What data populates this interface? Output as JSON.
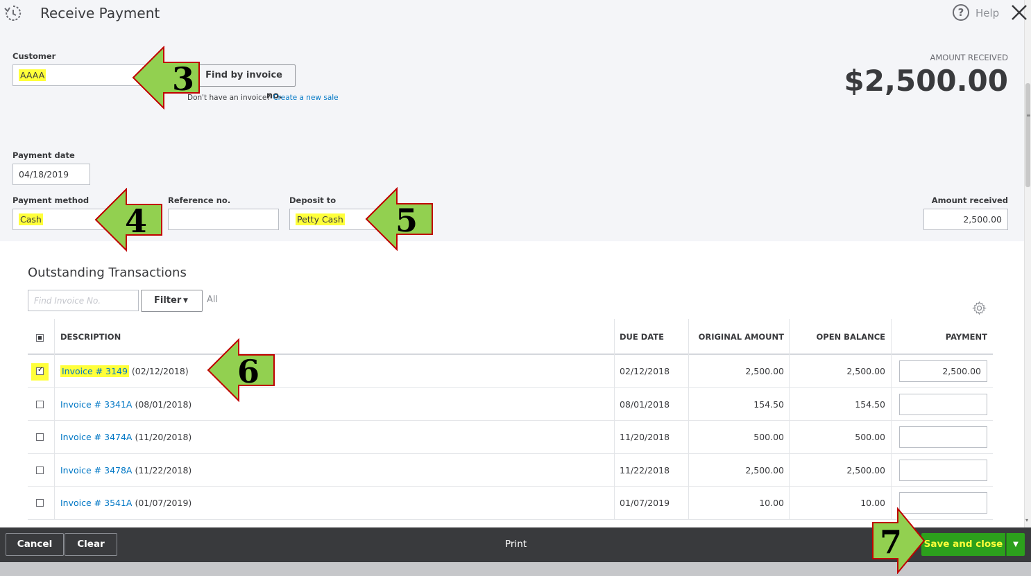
{
  "header": {
    "title": "Receive Payment",
    "help_label": "Help"
  },
  "customer": {
    "label": "Customer",
    "value": "AAAA",
    "find_button": "Find by invoice no.",
    "no_invoice_text": "Don't have an invoice?",
    "create_link": "Create a new sale"
  },
  "amount_received": {
    "label": "AMOUNT RECEIVED",
    "value": "$2,500.00",
    "field_label": "Amount received",
    "field_value": "2,500.00"
  },
  "payment_date": {
    "label": "Payment date",
    "value": "04/18/2019"
  },
  "payment_method": {
    "label": "Payment method",
    "value": "Cash"
  },
  "reference": {
    "label": "Reference no.",
    "value": ""
  },
  "deposit_to": {
    "label": "Deposit to",
    "value": "Petty Cash"
  },
  "outstanding": {
    "title": "Outstanding Transactions",
    "search_placeholder": "Find Invoice No.",
    "filter_label": "Filter",
    "all_label": "All",
    "columns": [
      "DESCRIPTION",
      "DUE DATE",
      "ORIGINAL AMOUNT",
      "OPEN BALANCE",
      "PAYMENT"
    ],
    "rows": [
      {
        "invoice": "Invoice # 3149",
        "date": "(02/12/2018)",
        "due": "02/12/2018",
        "original": "2,500.00",
        "open": "2,500.00",
        "payment": "2,500.00",
        "checked": true
      },
      {
        "invoice": "Invoice # 3341A",
        "date": "(08/01/2018)",
        "due": "08/01/2018",
        "original": "154.50",
        "open": "154.50",
        "payment": "",
        "checked": false
      },
      {
        "invoice": "Invoice # 3474A",
        "date": "(11/20/2018)",
        "due": "11/20/2018",
        "original": "500.00",
        "open": "500.00",
        "payment": "",
        "checked": false
      },
      {
        "invoice": "Invoice # 3478A",
        "date": "(11/22/2018)",
        "due": "11/22/2018",
        "original": "2,500.00",
        "open": "2,500.00",
        "payment": "",
        "checked": false
      },
      {
        "invoice": "Invoice # 3541A",
        "date": "(01/07/2019)",
        "due": "01/07/2019",
        "original": "10.00",
        "open": "10.00",
        "payment": "",
        "checked": false
      }
    ]
  },
  "footer": {
    "cancel": "Cancel",
    "clear": "Clear",
    "print": "Print",
    "save_close": "Save and close"
  },
  "callouts": [
    "3",
    "4",
    "5",
    "6",
    "7"
  ],
  "colors": {
    "highlight": "#ffff3a",
    "arrow_fill": "#92d050",
    "arrow_stroke": "#c00000",
    "link": "#0077c5",
    "save_button": "#2ca01c",
    "footer_bg": "#393a3d"
  }
}
